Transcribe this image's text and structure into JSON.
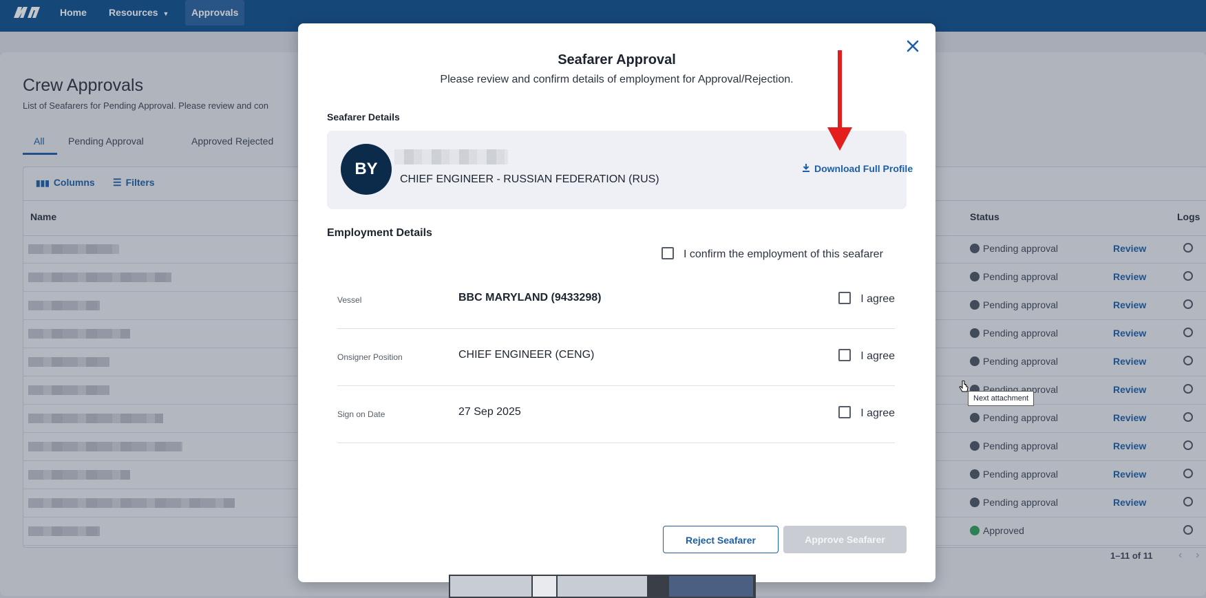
{
  "nav": {
    "home": "Home",
    "resources": "Resources",
    "approvals": "Approvals"
  },
  "page": {
    "title": "Crew Approvals",
    "subtitle": "List of Seafarers for Pending Approval. Please review and con",
    "tabs": [
      "All",
      "Pending Approval",
      "Approved",
      "Rejected"
    ],
    "toolbar": {
      "columns": "Columns",
      "filters": "Filters"
    },
    "columns": {
      "name": "Name",
      "status": "Status",
      "logs": "Logs"
    },
    "rows": [
      {
        "status": "Pending approval",
        "action": "Review"
      },
      {
        "status": "Pending approval",
        "action": "Review"
      },
      {
        "status": "Pending approval",
        "action": "Review"
      },
      {
        "status": "Pending approval",
        "action": "Review"
      },
      {
        "status": "Pending approval",
        "action": "Review"
      },
      {
        "status": "Pending approval",
        "action": "Review"
      },
      {
        "status": "Pending approval",
        "action": "Review"
      },
      {
        "status": "Pending approval",
        "action": "Review"
      },
      {
        "status": "Pending approval",
        "action": "Review"
      },
      {
        "status": "Pending approval",
        "action": "Review"
      },
      {
        "status": "Approved",
        "action": ""
      }
    ],
    "pagination": "1–11 of 11"
  },
  "modal": {
    "title": "Seafarer Approval",
    "subtitle": "Please review and confirm details of employment for Approval/Rejection.",
    "seafarer_details_label": "Seafarer Details",
    "avatar_initials": "BY",
    "rank_nationality": "CHIEF ENGINEER - RUSSIAN FEDERATION (RUS)",
    "download_label": "Download Full Profile",
    "employment_details_label": "Employment Details",
    "confirm_label": "I confirm the employment of this seafarer",
    "details": [
      {
        "label": "Vessel",
        "value": "BBC MARYLAND (9433298)",
        "agree": "I agree"
      },
      {
        "label": "Onsigner Position",
        "value": "CHIEF ENGINEER (CENG)",
        "agree": "I agree"
      },
      {
        "label": "Sign on Date",
        "value": "27 Sep 2025",
        "agree": "I agree"
      }
    ],
    "reject_label": "Reject Seafarer",
    "approve_label": "Approve Seafarer"
  },
  "tooltip": "Next attachment",
  "colors": {
    "brand": "#0f4f8e",
    "link": "#1e5ea5",
    "annotation": "#e41d1d",
    "approved": "#2e9e59"
  }
}
